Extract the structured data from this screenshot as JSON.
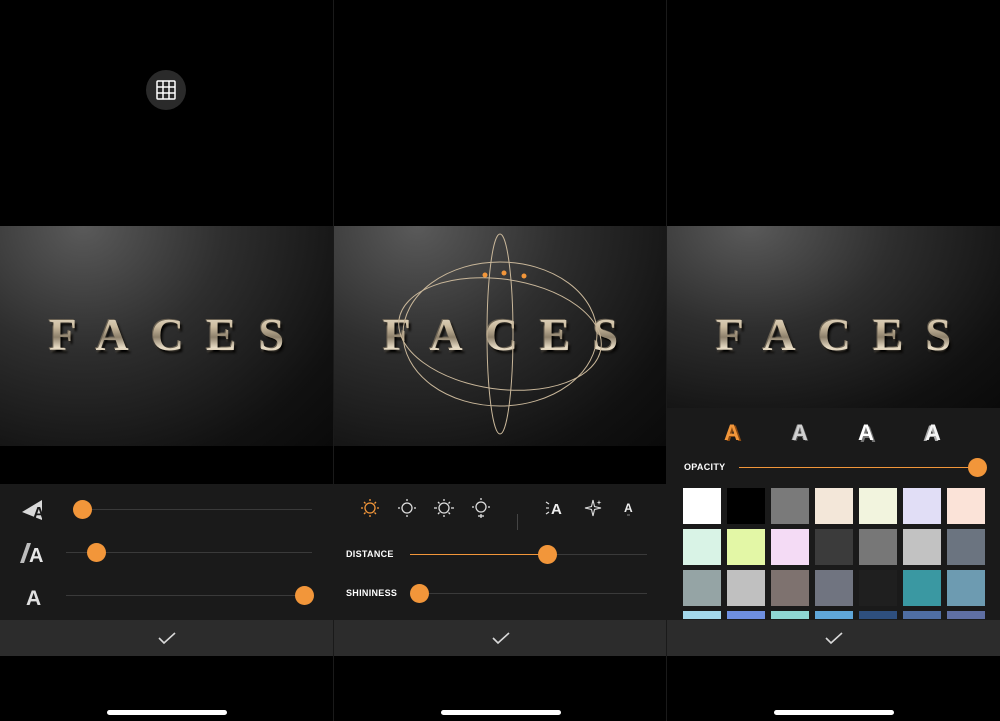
{
  "canvas_text": "FACES",
  "panel1": {
    "sliders": [
      {
        "icon": "light-direction-icon",
        "value": 0.03
      },
      {
        "icon": "depth-icon",
        "value": 0.12
      },
      {
        "icon": "letter-a-icon",
        "value": 1.0
      }
    ]
  },
  "panel2": {
    "light_icons": [
      "light-front-icon",
      "light-top-icon",
      "light-side-icon",
      "light-bottom-icon",
      "text-light-icon",
      "sparkle-icon",
      "letter-small-icon"
    ],
    "distance_label": "DISTANCE",
    "distance_value": 0.58,
    "shininess_label": "SHININESS",
    "shininess_value": 0.0
  },
  "panel3": {
    "styles": [
      "style-orange-a",
      "style-bevel-a",
      "style-3d-a",
      "style-outline-a"
    ],
    "opacity_label": "OPACITY",
    "opacity_value": 1.0,
    "swatch_rows": [
      [
        "#ffffff",
        "#000000",
        "#7a7a7a",
        "#f3e7d9",
        "#f2f4de",
        "#e1def6",
        "#fbe3d8"
      ],
      [
        "#d9f3e6",
        "#e3f7a6",
        "#f4dbf5",
        "#3b3b3b",
        "#777777",
        "#c2c2c2",
        "#6b7480"
      ],
      [
        "#95a4a5",
        "#c0c0c0",
        "#7e726f",
        "#707480",
        "#1f1f1f",
        "#3a98a2",
        "#6d9bb1"
      ],
      [
        "#a3d7ea",
        "#6e8fe0",
        "#8fd6d2",
        "#5fa6d9",
        "#2e4f7e",
        "#4f6ea3",
        "#5f6fa3"
      ]
    ]
  },
  "colors": {
    "accent": "#f2963a",
    "panel_bg": "#1a1a1a",
    "bottom_bar": "#2c2c2c"
  }
}
